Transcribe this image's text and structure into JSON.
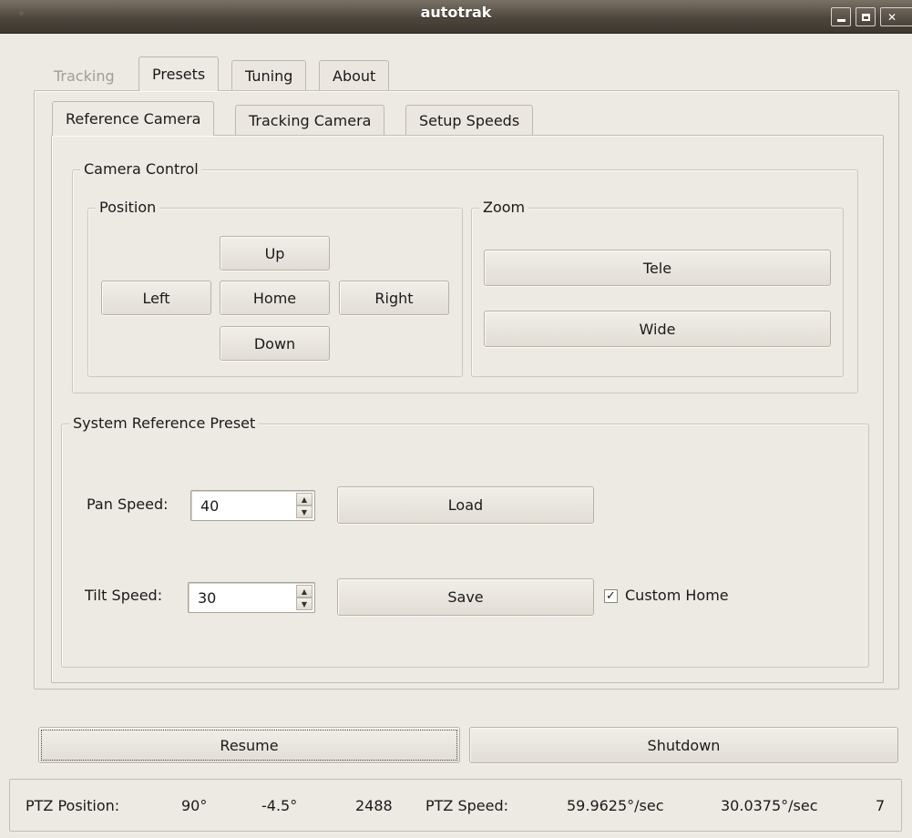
{
  "window": {
    "title": "autotrak",
    "menu_icon": "window-menu-icon",
    "min_icon": "minimize-icon",
    "max_icon": "maximize-icon",
    "close_icon": "close-icon"
  },
  "main_tabs": [
    "Tracking",
    "Presets",
    "Tuning",
    "About"
  ],
  "sub_tabs": [
    "Reference Camera",
    "Tracking Camera",
    "Setup Speeds"
  ],
  "camera_control": {
    "title": "Camera Control",
    "position": {
      "title": "Position",
      "up": "Up",
      "left": "Left",
      "home": "Home",
      "right": "Right",
      "down": "Down"
    },
    "zoom": {
      "title": "Zoom",
      "tele": "Tele",
      "wide": "Wide"
    }
  },
  "preset": {
    "title": "System Reference Preset",
    "pan_label": "Pan Speed:",
    "pan_value": "40",
    "tilt_label": "Tilt Speed:",
    "tilt_value": "30",
    "load": "Load",
    "save": "Save",
    "custom_home_label": "Custom Home",
    "custom_home_checked": true
  },
  "actions": {
    "resume": "Resume",
    "shutdown": "Shutdown"
  },
  "status": {
    "ptz_position_label": "PTZ Position:",
    "pan": "90°",
    "tilt": "-4.5°",
    "zoom": "2488",
    "ptz_speed_label": "PTZ Speed:",
    "pan_speed": "59.9625°/sec",
    "tilt_speed": "30.0375°/sec",
    "zoom_speed": "7"
  }
}
